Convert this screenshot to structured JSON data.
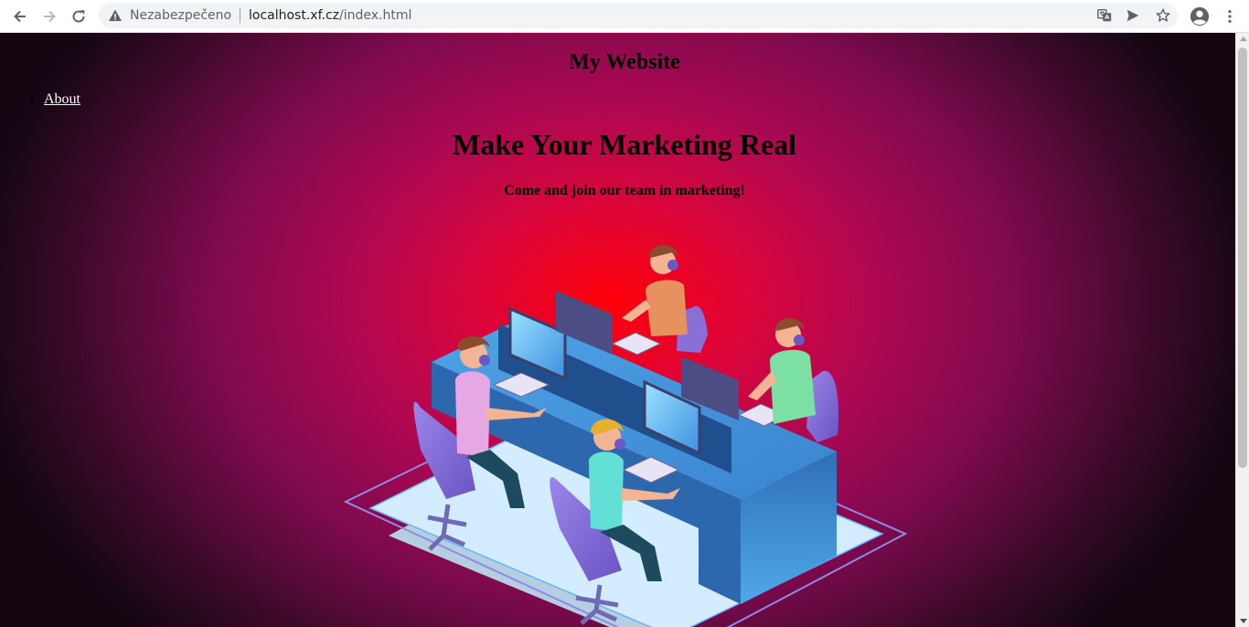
{
  "browser": {
    "security_label": "Nezabezpečeno",
    "url_host": "localhost.xf.cz",
    "url_path": "/index.html"
  },
  "icons": {
    "back": "back-arrow-icon",
    "forward": "forward-arrow-icon",
    "reload": "reload-icon",
    "warning": "warning-triangle-icon",
    "translate": "translate-icon",
    "send": "send-icon",
    "star": "star-icon",
    "profile": "profile-icon",
    "menu": "kebab-menu-icon"
  },
  "page": {
    "site_title": "My Website",
    "nav": [
      {
        "label": "About"
      }
    ],
    "hero_title": "Make Your Marketing Real",
    "hero_subtitle": "Come and join our team in marketing!",
    "illustration": "marketing-team-illustration"
  },
  "colors": {
    "background_center": "#ff0008",
    "background_edge": "#140712",
    "link": "#ffffff",
    "desk": "#3f8fd6",
    "chair": "#8a6fd8"
  }
}
